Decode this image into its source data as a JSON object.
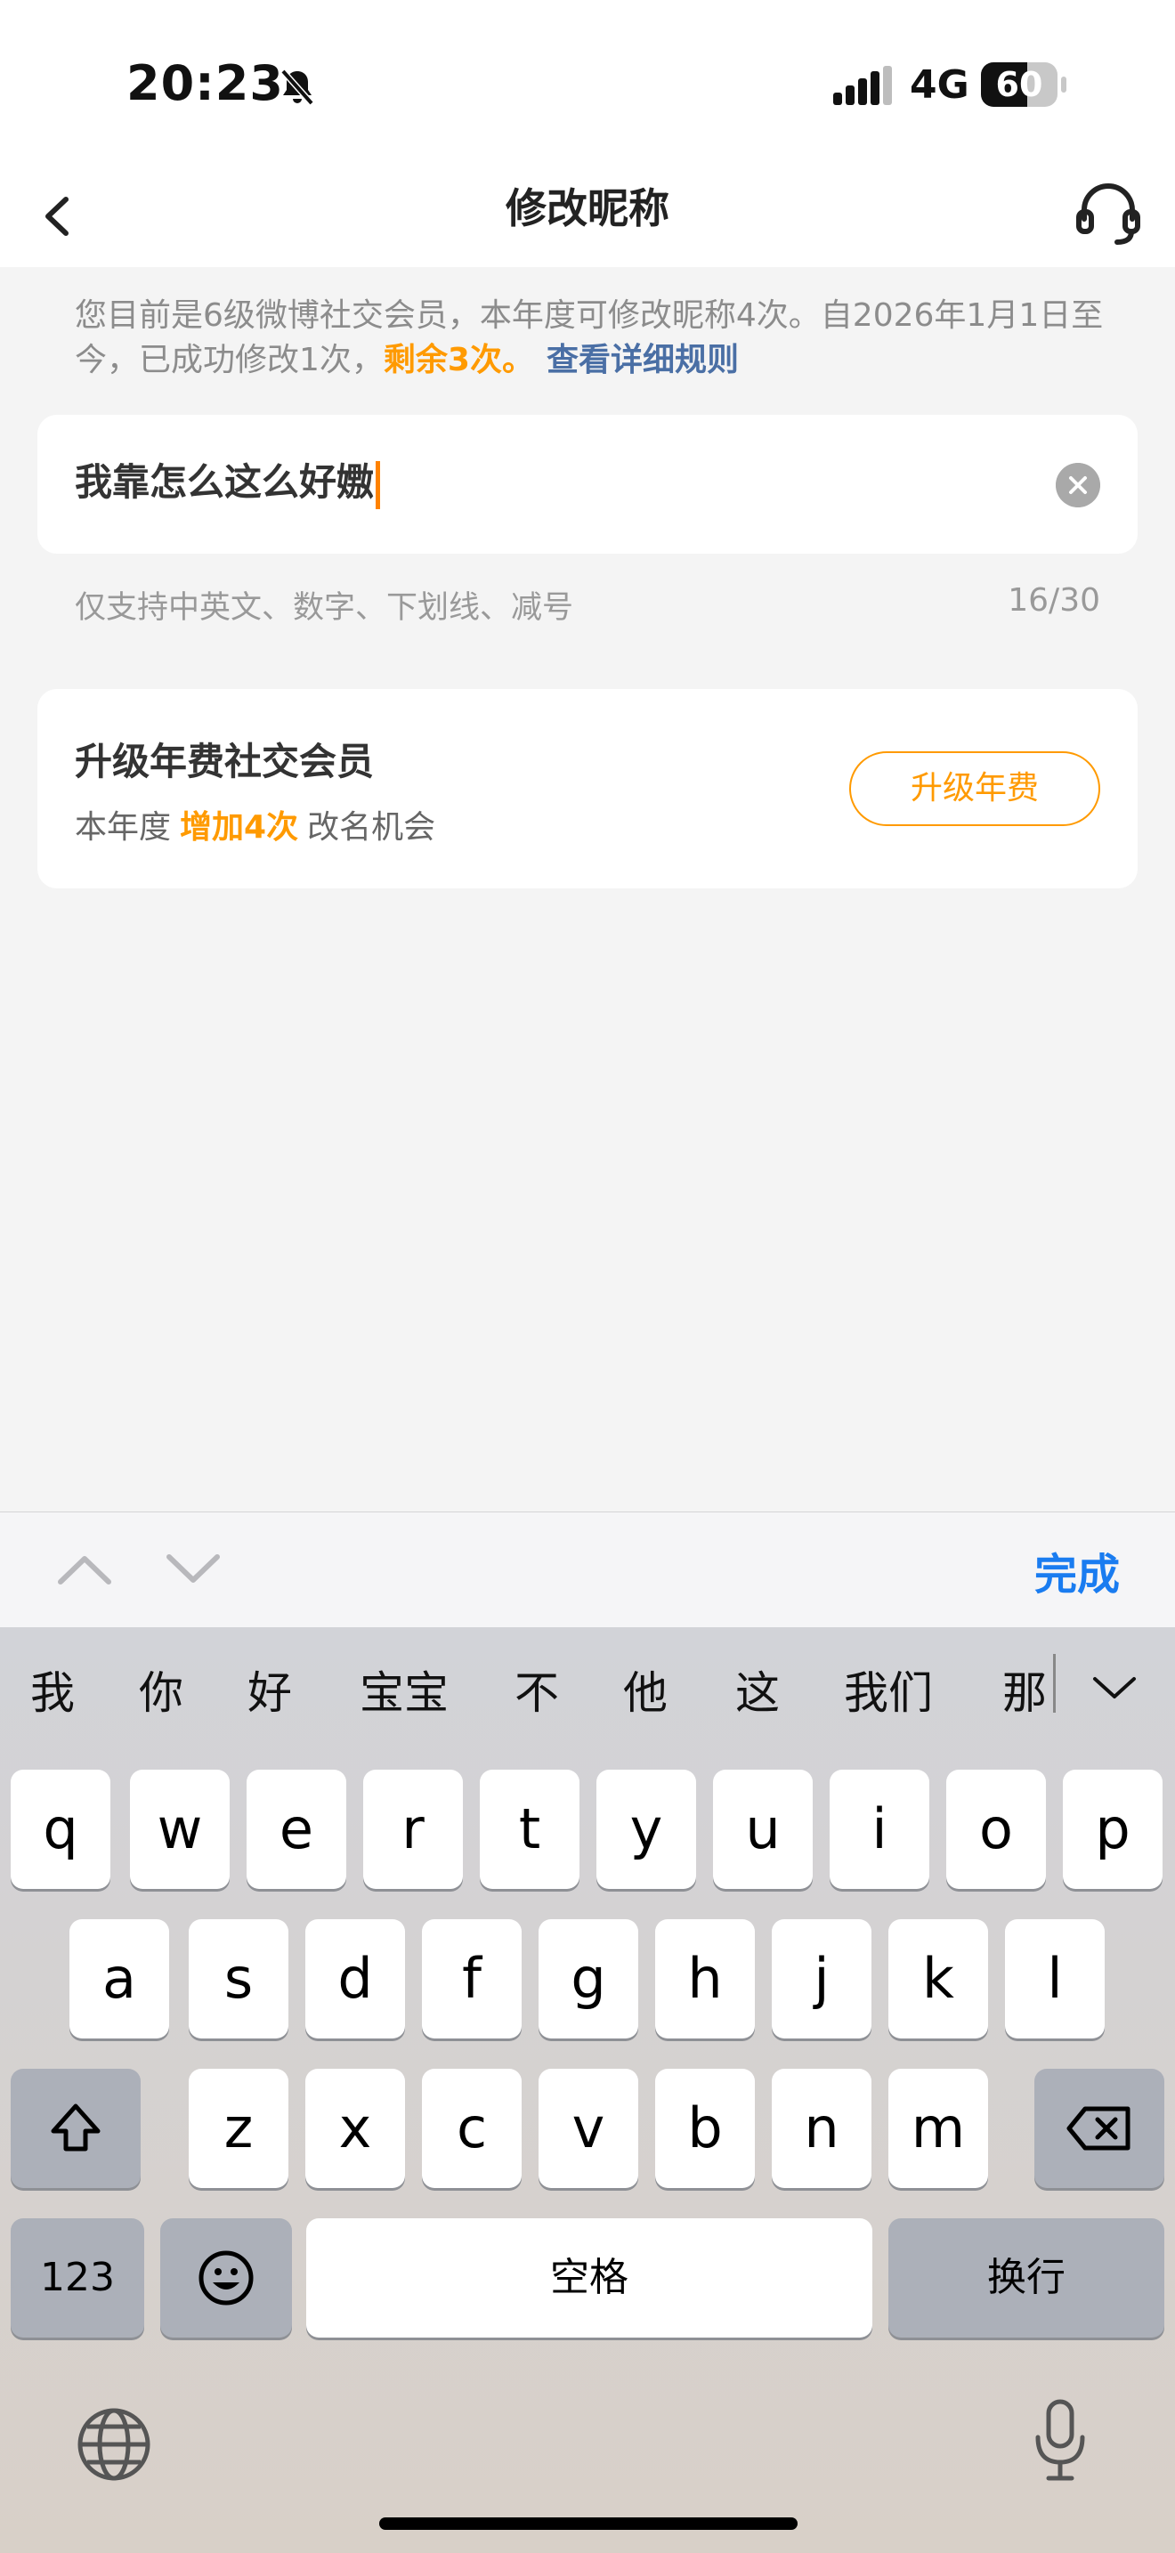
{
  "status_bar": {
    "time": "20:23",
    "network": "4G",
    "battery_text": "60",
    "battery_level": 0.6
  },
  "nav": {
    "title": "修改昵称"
  },
  "notice": {
    "text": "您目前是6级微博社交会员，本年度可修改昵称4次。自2026年1月1日至今，已成功修改1次，",
    "remain": "剩余3次。",
    "rules_link": "查看详细规则"
  },
  "nickname_input": {
    "value": "我靠怎么这么好嫐"
  },
  "hint": {
    "text": "仅支持中英文、数字、下划线、减号",
    "count": "16/30"
  },
  "upgrade": {
    "title": "升级年费社交会员",
    "sub_prefix": "本年度",
    "sub_highlight": "增加4次",
    "sub_suffix": "改名机会",
    "button": "升级年费"
  },
  "accessory": {
    "done_label": "完成"
  },
  "keyboard": {
    "candidates": [
      "我",
      "你",
      "好",
      "宝宝",
      "不",
      "他",
      "这",
      "我们",
      "那"
    ],
    "row1": [
      "q",
      "w",
      "e",
      "r",
      "t",
      "y",
      "u",
      "i",
      "o",
      "p"
    ],
    "row2": [
      "a",
      "s",
      "d",
      "f",
      "g",
      "h",
      "j",
      "k",
      "l"
    ],
    "row3": [
      "z",
      "x",
      "c",
      "v",
      "b",
      "n",
      "m"
    ],
    "numbers_label": "123",
    "space_label": "空格",
    "return_label": "换行"
  },
  "colors": {
    "accent_orange": "#ff9a00",
    "link_blue": "#4a6fa5",
    "done_blue": "#1a7cf0",
    "caret_orange": "#ff8200"
  }
}
